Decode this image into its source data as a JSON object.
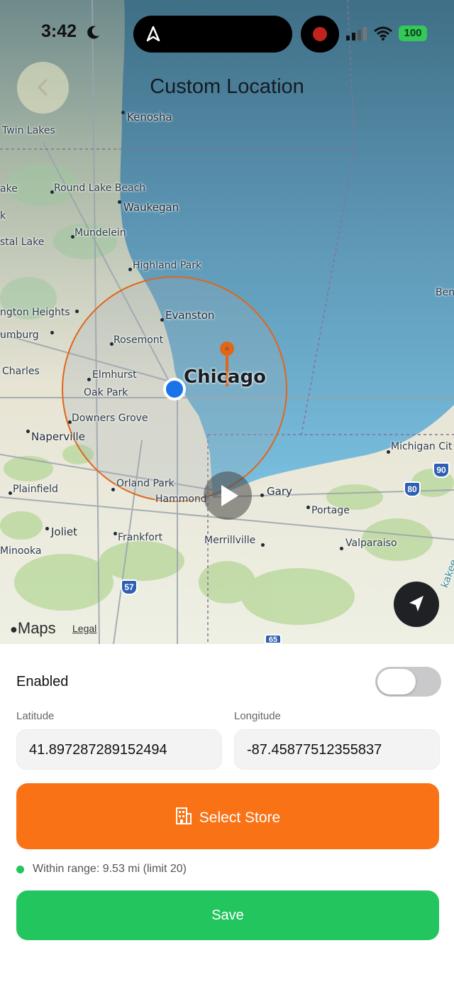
{
  "status_bar": {
    "time": "3:42",
    "battery": "100"
  },
  "header": {
    "title": "Custom Location"
  },
  "map": {
    "labels": {
      "kenosha": "Kenosha",
      "twin_lakes": "Twin Lakes",
      "lake": "ake",
      "round_lake_beach": "Round Lake Beach",
      "waukegan": "Waukegan",
      "k": "k",
      "mundelein": "Mundelein",
      "crystal_lake": "stal Lake",
      "highland_park": "Highland Park",
      "benton": "Ben",
      "arlington_heights": "ngton Heights",
      "evanston": "Evanston",
      "schaumburg": "umburg",
      "rosemont": "Rosemont",
      "st_charles": "Charles",
      "elmhurst": "Elmhurst",
      "chicago": "Chicago",
      "oak_park": "Oak Park",
      "downers_grove": "Downers Grove",
      "naperville": "Naperville",
      "michigan_city": "Michigan Cit",
      "plainfield": "Plainfield",
      "orland_park": "Orland Park",
      "hammond": "Hammond",
      "gary": "Gary",
      "portage": "Portage",
      "joliet": "Joliet",
      "frankfort": "Frankfort",
      "merrillville": "Merrillville",
      "valparaiso": "Valparaiso",
      "minooka": "Minooka",
      "shield_90": "90",
      "shield_80": "80",
      "shield_57": "57",
      "shield_65": "65",
      "kankakee_partial": "kakee"
    },
    "maps_logo": "Maps",
    "legal": "Legal",
    "radius_color": "#e0661a",
    "pin_color": "#e0661a",
    "user_dot_color": "#1a73e8"
  },
  "form": {
    "enabled_label": "Enabled",
    "enabled": false,
    "latitude_label": "Latitude",
    "latitude_value": "41.897287289152494",
    "longitude_label": "Longitude",
    "longitude_value": "-87.45877512355837",
    "select_store_label": "Select Store",
    "range_text": "Within range: 9.53 mi (limit 20)",
    "save_label": "Save"
  },
  "colors": {
    "accent_orange": "#f97316",
    "save_green": "#22c55e",
    "status_dot_green": "#22c55e"
  },
  "icons": {
    "back": "chevron-left-icon",
    "status_moon": "moon-icon",
    "location_arrow": "location-arrow-icon",
    "play": "play-icon",
    "locate": "navigation-arrow-icon",
    "store": "building-icon",
    "apple": "apple-icon"
  }
}
